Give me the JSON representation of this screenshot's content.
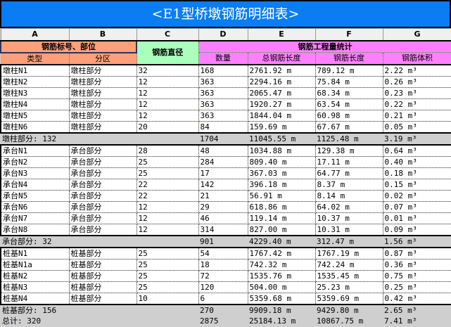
{
  "title": "<E1型桥墩钢筋明细表>",
  "columns": [
    "A",
    "B",
    "C",
    "D",
    "E",
    "F",
    "G"
  ],
  "headers": {
    "group1": "钢筋标号、部位",
    "diameter": "钢筋直径",
    "group2": "钢筋工程量统计",
    "type": "类型",
    "zone": "分区",
    "count": "数量",
    "total_length": "总钢筋长度",
    "length": "钢筋长度",
    "volume": "钢筋体积"
  },
  "groups": [
    {
      "rows": [
        [
          "墩柱N1",
          "墩柱部分",
          "32",
          "168",
          "2761.92 m",
          "789.12 m",
          "2.22 m³"
        ],
        [
          "墩柱N2",
          "墩柱部分",
          "12",
          "363",
          "2294.16 m",
          "75.84 m",
          "0.26 m³"
        ],
        [
          "墩柱N3",
          "墩柱部分",
          "12",
          "363",
          "2065.47 m",
          "68.34 m",
          "0.23 m³"
        ],
        [
          "墩柱N4",
          "墩柱部分",
          "12",
          "363",
          "1920.27 m",
          "63.54 m",
          "0.22 m³"
        ],
        [
          "墩柱N5",
          "墩柱部分",
          "12",
          "363",
          "1844.04 m",
          "60.98 m",
          "0.21 m³"
        ],
        [
          "墩柱N6",
          "墩柱部分",
          "20",
          "84",
          "159.69 m",
          "67.67 m",
          "0.05 m³"
        ]
      ],
      "subtotal": [
        "墩柱部分: 132",
        "1704",
        "11045.55 m",
        "1125.48 m",
        "3.19 m³"
      ]
    },
    {
      "rows": [
        [
          "承台N1",
          "承台部分",
          "28",
          "48",
          "1034.88 m",
          "129.38 m",
          "0.64 m³"
        ],
        [
          "承台N2",
          "承台部分",
          "25",
          "284",
          "809.40 m",
          "17.11 m",
          "0.40 m³"
        ],
        [
          "承台N3",
          "承台部分",
          "25",
          "17",
          "367.03 m",
          "64.77 m",
          "0.18 m³"
        ],
        [
          "承台N4",
          "承台部分",
          "22",
          "142",
          "396.18 m",
          "8.37 m",
          "0.15 m³"
        ],
        [
          "承台N5",
          "承台部分",
          "22",
          "21",
          "56.91 m",
          "8.14 m",
          "0.02 m³"
        ],
        [
          "承台N6",
          "承台部分",
          "12",
          "29",
          "618.86 m",
          "64.02 m",
          "0.07 m³"
        ],
        [
          "承台N7",
          "承台部分",
          "12",
          "46",
          "119.14 m",
          "10.37 m",
          "0.01 m³"
        ],
        [
          "承台N8",
          "承台部分",
          "12",
          "314",
          "827.00 m",
          "10.31 m",
          "0.09 m³"
        ]
      ],
      "subtotal": [
        "承台部分: 32",
        "901",
        "4229.40 m",
        "312.47 m",
        "1.56 m³"
      ]
    },
    {
      "rows": [
        [
          "桩基N1",
          "桩基部分",
          "25",
          "54",
          "1767.42 m",
          "1767.19 m",
          "0.87 m³"
        ],
        [
          "桩基N1a",
          "桩基部分",
          "25",
          "18",
          "742.32 m",
          "742.24 m",
          "0.36 m³"
        ],
        [
          "桩基N2",
          "桩基部分",
          "25",
          "72",
          "1535.76 m",
          "1535.45 m",
          "0.75 m³"
        ],
        [
          "桩基N3",
          "桩基部分",
          "25",
          "120",
          "504.00 m",
          "25.23 m",
          "0.25 m³"
        ],
        [
          "桩基N4",
          "桩基部分",
          "10",
          "6",
          "5359.68 m",
          "5359.69 m",
          "0.42 m³"
        ]
      ],
      "subtotal": [
        "桩基部分: 156",
        "270",
        "9909.18 m",
        "9429.80 m",
        "2.65 m³"
      ]
    }
  ],
  "total": [
    "总计: 320",
    "2875",
    "25184.13 m",
    "10867.75 m",
    "7.41 m³"
  ]
}
